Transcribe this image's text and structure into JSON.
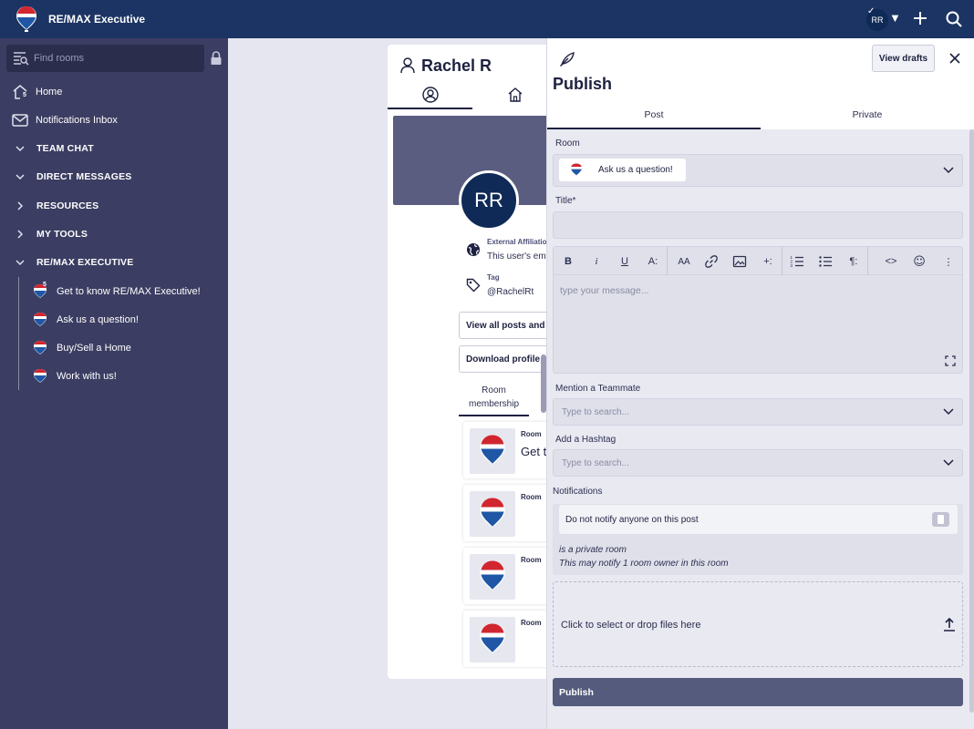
{
  "app": {
    "title": "RE/MAX Executive"
  },
  "topbar": {
    "avatar_initials": "RR",
    "avatar_check": "✓",
    "caret": "▼"
  },
  "sidebar": {
    "search_placeholder": "Find rooms",
    "home_badge": "5",
    "items": [
      {
        "label": "Home",
        "icon": "home-icon"
      },
      {
        "label": "Notifications Inbox",
        "icon": "mail-icon"
      }
    ],
    "sections": [
      {
        "label": "TEAM CHAT",
        "expanded": true
      },
      {
        "label": "DIRECT MESSAGES",
        "expanded": true
      },
      {
        "label": "RESOURCES",
        "expanded": false
      },
      {
        "label": "MY TOOLS",
        "expanded": false
      },
      {
        "label": "RE/MAX EXECUTIVE",
        "expanded": true
      }
    ],
    "rooms": [
      {
        "label": "Get to know RE/MAX Executive!",
        "badge": "5"
      },
      {
        "label": "Ask us a question!"
      },
      {
        "label": "Buy/Sell a Home"
      },
      {
        "label": "Work with us!"
      }
    ]
  },
  "profile": {
    "name": "Rachel R",
    "initials": "RR",
    "external_label": "External Affiliation",
    "external_value": "This user's email",
    "tag_label": "Tag",
    "tag_value": "@RachelRt",
    "view_all_button": "View all posts and replies",
    "download_button": "Download profile",
    "room_membership_tab": "Room membership",
    "memberships": [
      {
        "label": "Room",
        "name": "Get to know RE/MAX Executive!"
      },
      {
        "label": "Room",
        "name": ""
      },
      {
        "label": "Room",
        "name": ""
      },
      {
        "label": "Room",
        "name": ""
      }
    ]
  },
  "publish": {
    "title": "Publish",
    "view_drafts": "View drafts",
    "tabs": [
      "Post",
      "Private"
    ],
    "active_tab": "Post",
    "room_label": "Room",
    "room_value": "Ask us a question!",
    "title_label": "Title*",
    "editor_placeholder": "type your message...",
    "mention_label": "Mention a Teammate",
    "mention_placeholder": "Type to search...",
    "hashtag_label": "Add a Hashtag",
    "hashtag_placeholder": "Type to search...",
    "notifications_label": "Notifications",
    "notify_option": "Do not notify anyone on this post",
    "private_line1": "is a private room",
    "private_line2": "This may notify 1 room owner in this room",
    "drop_text": "Click to select or drop files here",
    "submit": "Publish",
    "toolbar": [
      "B",
      "i",
      "U",
      "A:",
      "AA",
      "link",
      "image",
      "+:",
      "ol",
      "ul",
      "¶:",
      "<>",
      "☺",
      "⋮"
    ]
  },
  "colors": {
    "topbar": "#1c3463",
    "sidebar": "#3b3d62",
    "accent": "#545b7c",
    "avatar": "#0f2a57"
  }
}
